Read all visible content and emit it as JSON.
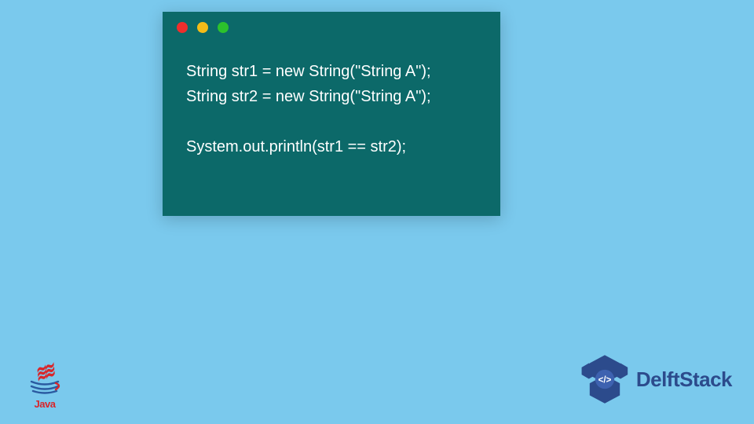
{
  "code": {
    "line1": "String str1 = new String(\"String A\");",
    "line2": "String str2 = new String(\"String A\");",
    "blank": " ",
    "line3": "System.out.println(str1 == str2);"
  },
  "logos": {
    "java_label": "Java",
    "delft_label": "DelftStack"
  }
}
